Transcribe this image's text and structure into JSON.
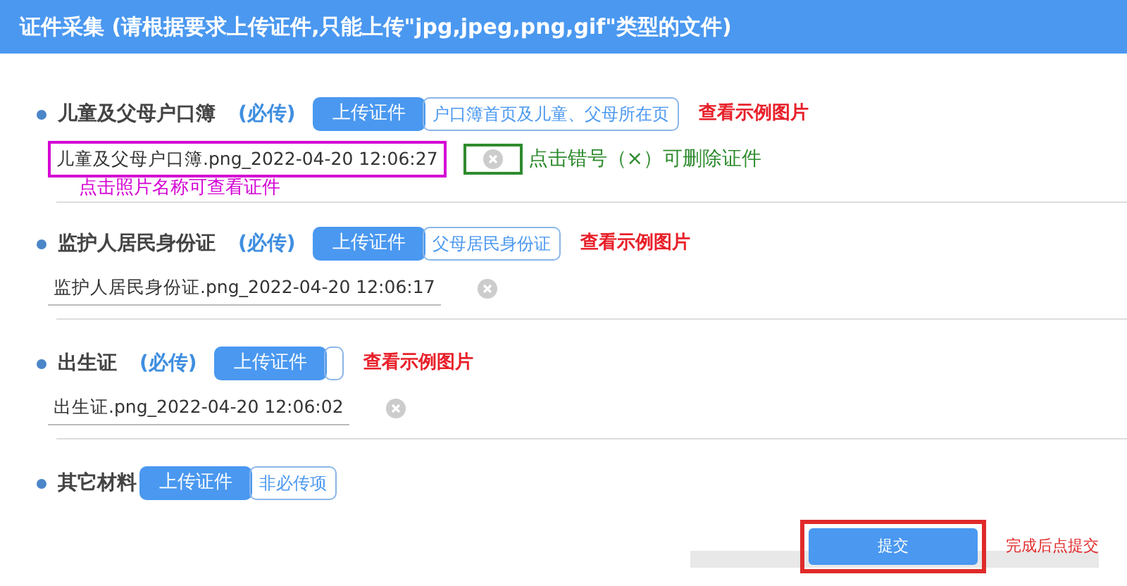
{
  "header": {
    "title": "证件采集 (请根据要求上传证件,只能上传\"jpg,jpeg,png,gif\"类型的文件)"
  },
  "sections": [
    {
      "name": "儿童及父母户口簿",
      "required": "(必传)",
      "upload": "上传证件",
      "hint": "户口簿首页及儿童、父母所在页",
      "example": "查看示例图片",
      "file": {
        "name": "儿童及父母户口簿.png_2022-04-20 12:06:27",
        "highlighted": true
      },
      "delete_note": "点击错号（×）可删除证件",
      "view_note": "点击照片名称可查看证件"
    },
    {
      "name": "监护人居民身份证",
      "required": "(必传)",
      "upload": "上传证件",
      "hint": "父母居民身份证",
      "example": "查看示例图片",
      "file": {
        "name": "监护人居民身份证.png_2022-04-20 12:06:17",
        "highlighted": false
      }
    },
    {
      "name": "出生证",
      "required": "(必传)",
      "upload": "上传证件",
      "example": "查看示例图片",
      "file": {
        "name": "出生证.png_2022-04-20 12:06:02",
        "highlighted": false
      }
    },
    {
      "name": "其它材料",
      "upload": "上传证件",
      "hint": "非必传项"
    }
  ],
  "submit": {
    "label": "提交",
    "highlighted": true,
    "note": "完成后点提交"
  }
}
